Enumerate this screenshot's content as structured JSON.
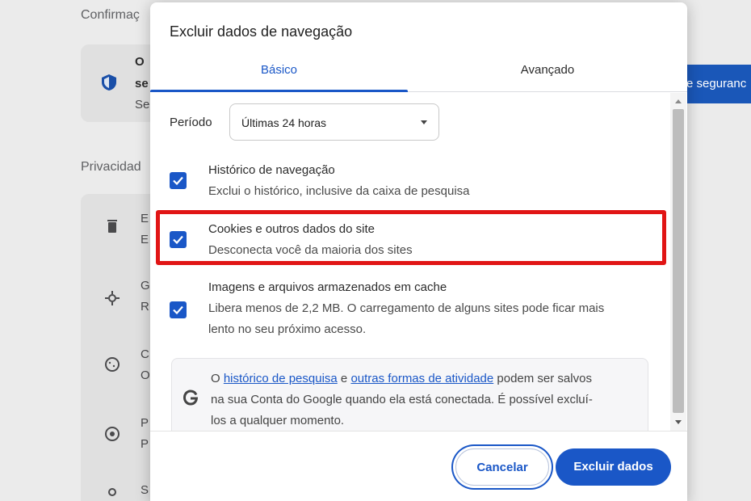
{
  "background": {
    "section_confirm": "Confirmaç",
    "card_text_1": "O",
    "card_text_2": "se",
    "card_text_3": "Se",
    "security_button": "e seguranc",
    "section_privacy": "Privacidad",
    "rows": [
      {
        "a": "E",
        "b": "E"
      },
      {
        "a": "G",
        "b": "R"
      },
      {
        "a": "C",
        "b": "O"
      },
      {
        "a": "P",
        "b": "P"
      },
      {
        "a": "S",
        "b": ""
      }
    ]
  },
  "dialog": {
    "title": "Excluir dados de navegação",
    "tabs": [
      {
        "label": "Básico",
        "active": true
      },
      {
        "label": "Avançado",
        "active": false
      }
    ],
    "period": {
      "label": "Período",
      "value": "Últimas 24 horas"
    },
    "options": [
      {
        "title": "Histórico de navegação",
        "description": "Exclui o histórico, inclusive da caixa de pesquisa",
        "checked": true
      },
      {
        "title": "Cookies e outros dados do site",
        "description": "Desconecta você da maioria dos sites",
        "checked": true
      },
      {
        "title": "Imagens e arquivos armazenados em cache",
        "description_line1": "Libera menos de 2,2 MB. O carregamento de alguns sites pode ficar mais",
        "description_line2": "lento no seu próximo acesso.",
        "checked": true
      }
    ],
    "google_notice": {
      "prefix": "O ",
      "link1": "histórico de pesquisa",
      "middle": " e ",
      "link2": "outras formas de atividade",
      "suffix_line1": " podem ser salvos",
      "line2": "na sua Conta do Google quando ela está conectada. É possível excluí-",
      "line3": "los a qualquer momento."
    },
    "buttons": {
      "cancel": "Cancelar",
      "confirm": "Excluir dados"
    }
  },
  "colors": {
    "accent": "#1a57c7",
    "highlight": "#e11515"
  }
}
